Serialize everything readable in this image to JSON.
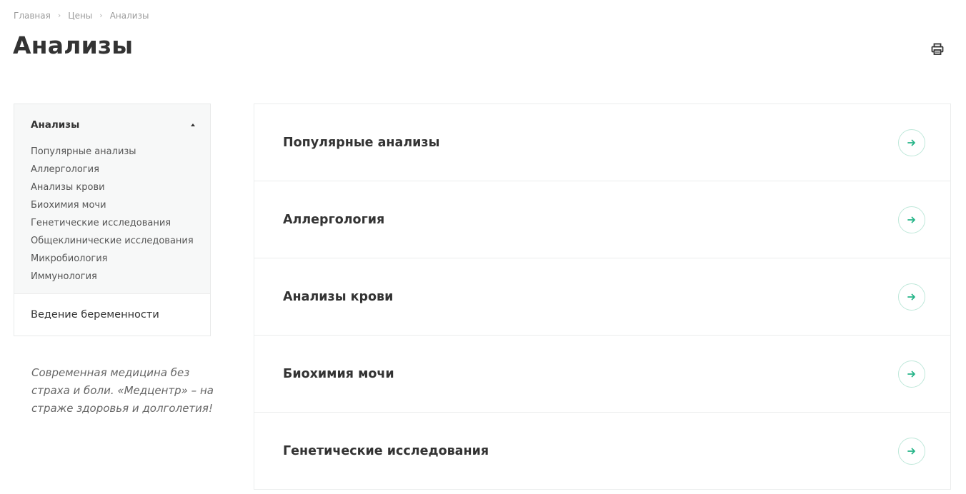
{
  "breadcrumb": [
    {
      "label": "Главная"
    },
    {
      "label": "Цены"
    },
    {
      "label": "Анализы"
    }
  ],
  "page_title": "Анализы",
  "print_icon": "printer-icon",
  "sidebar": {
    "group_title": "Анализы",
    "group_items": [
      "Популярные анализы",
      "Аллергология",
      "Анализы крови",
      "Биохимия мочи",
      "Генетические исследования",
      "Общеклинические исследования",
      "Микробиология",
      "Иммунология"
    ],
    "standalone_item": "Ведение беременности"
  },
  "slogan": "Современная медицина без страха и боли. «Медцентр» – на страже здоровья и долголетия!",
  "cards": [
    {
      "title": "Популярные анализы"
    },
    {
      "title": "Аллергология"
    },
    {
      "title": "Анализы крови"
    },
    {
      "title": "Биохимия мочи"
    },
    {
      "title": "Генетические исследования"
    }
  ],
  "colors": {
    "accent": "#27b589",
    "accent_border": "#bfe8da",
    "sidebar_bg": "#f7f8f8",
    "text": "#333333"
  }
}
